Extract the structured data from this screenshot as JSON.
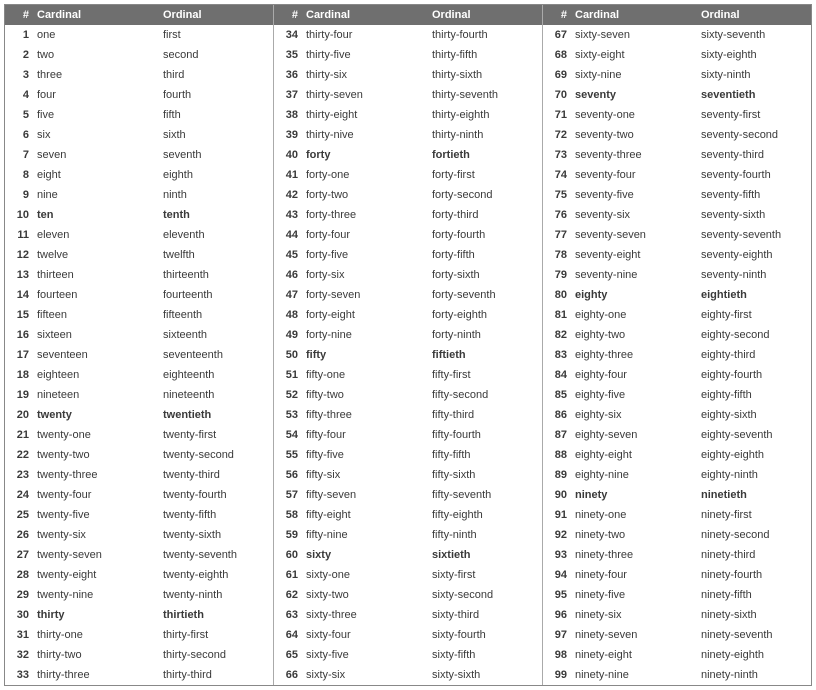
{
  "headers": {
    "num": "#",
    "cardinal": "Cardinal",
    "ordinal": "Ordinal"
  },
  "columns": [
    {
      "rows": [
        {
          "n": "1",
          "cardinal": "one",
          "ordinal": "first",
          "bold": false
        },
        {
          "n": "2",
          "cardinal": "two",
          "ordinal": "second",
          "bold": false
        },
        {
          "n": "3",
          "cardinal": "three",
          "ordinal": "third",
          "bold": false
        },
        {
          "n": "4",
          "cardinal": "four",
          "ordinal": "fourth",
          "bold": false
        },
        {
          "n": "5",
          "cardinal": "five",
          "ordinal": "fifth",
          "bold": false
        },
        {
          "n": "6",
          "cardinal": "six",
          "ordinal": "sixth",
          "bold": false
        },
        {
          "n": "7",
          "cardinal": "seven",
          "ordinal": "seventh",
          "bold": false
        },
        {
          "n": "8",
          "cardinal": "eight",
          "ordinal": "eighth",
          "bold": false
        },
        {
          "n": "9",
          "cardinal": "nine",
          "ordinal": "ninth",
          "bold": false
        },
        {
          "n": "10",
          "cardinal": "ten",
          "ordinal": "tenth",
          "bold": true
        },
        {
          "n": "11",
          "cardinal": "eleven",
          "ordinal": "eleventh",
          "bold": false
        },
        {
          "n": "12",
          "cardinal": "twelve",
          "ordinal": "twelfth",
          "bold": false
        },
        {
          "n": "13",
          "cardinal": "thirteen",
          "ordinal": "thirteenth",
          "bold": false
        },
        {
          "n": "14",
          "cardinal": "fourteen",
          "ordinal": "fourteenth",
          "bold": false
        },
        {
          "n": "15",
          "cardinal": "fifteen",
          "ordinal": "fifteenth",
          "bold": false
        },
        {
          "n": "16",
          "cardinal": "sixteen",
          "ordinal": "sixteenth",
          "bold": false
        },
        {
          "n": "17",
          "cardinal": "seventeen",
          "ordinal": "seventeenth",
          "bold": false
        },
        {
          "n": "18",
          "cardinal": "eighteen",
          "ordinal": "eighteenth",
          "bold": false
        },
        {
          "n": "19",
          "cardinal": "nineteen",
          "ordinal": "nineteenth",
          "bold": false
        },
        {
          "n": "20",
          "cardinal": "twenty",
          "ordinal": "twentieth",
          "bold": true
        },
        {
          "n": "21",
          "cardinal": "twenty-one",
          "ordinal": "twenty-first",
          "bold": false
        },
        {
          "n": "22",
          "cardinal": "twenty-two",
          "ordinal": "twenty-second",
          "bold": false
        },
        {
          "n": "23",
          "cardinal": "twenty-three",
          "ordinal": "twenty-third",
          "bold": false
        },
        {
          "n": "24",
          "cardinal": "twenty-four",
          "ordinal": "twenty-fourth",
          "bold": false
        },
        {
          "n": "25",
          "cardinal": "twenty-five",
          "ordinal": "twenty-fifth",
          "bold": false
        },
        {
          "n": "26",
          "cardinal": "twenty-six",
          "ordinal": "twenty-sixth",
          "bold": false
        },
        {
          "n": "27",
          "cardinal": "twenty-seven",
          "ordinal": "twenty-seventh",
          "bold": false
        },
        {
          "n": "28",
          "cardinal": "twenty-eight",
          "ordinal": "twenty-eighth",
          "bold": false
        },
        {
          "n": "29",
          "cardinal": "twenty-nine",
          "ordinal": "twenty-ninth",
          "bold": false
        },
        {
          "n": "30",
          "cardinal": "thirty",
          "ordinal": "thirtieth",
          "bold": true
        },
        {
          "n": "31",
          "cardinal": "thirty-one",
          "ordinal": "thirty-first",
          "bold": false
        },
        {
          "n": "32",
          "cardinal": "thirty-two",
          "ordinal": "thirty-second",
          "bold": false
        },
        {
          "n": "33",
          "cardinal": "thirty-three",
          "ordinal": "thirty-third",
          "bold": false
        }
      ]
    },
    {
      "rows": [
        {
          "n": "34",
          "cardinal": "thirty-four",
          "ordinal": "thirty-fourth",
          "bold": false
        },
        {
          "n": "35",
          "cardinal": "thirty-five",
          "ordinal": "thirty-fifth",
          "bold": false
        },
        {
          "n": "36",
          "cardinal": "thirty-six",
          "ordinal": "thirty-sixth",
          "bold": false
        },
        {
          "n": "37",
          "cardinal": "thirty-seven",
          "ordinal": "thirty-seventh",
          "bold": false
        },
        {
          "n": "38",
          "cardinal": "thirty-eight",
          "ordinal": "thirty-eighth",
          "bold": false
        },
        {
          "n": "39",
          "cardinal": "thirty-nive",
          "ordinal": "thirty-ninth",
          "bold": false
        },
        {
          "n": "40",
          "cardinal": "forty",
          "ordinal": "fortieth",
          "bold": true
        },
        {
          "n": "41",
          "cardinal": "forty-one",
          "ordinal": "forty-first",
          "bold": false
        },
        {
          "n": "42",
          "cardinal": "forty-two",
          "ordinal": "forty-second",
          "bold": false
        },
        {
          "n": "43",
          "cardinal": "forty-three",
          "ordinal": "forty-third",
          "bold": false
        },
        {
          "n": "44",
          "cardinal": "forty-four",
          "ordinal": "forty-fourth",
          "bold": false
        },
        {
          "n": "45",
          "cardinal": "forty-five",
          "ordinal": "forty-fifth",
          "bold": false
        },
        {
          "n": "46",
          "cardinal": "forty-six",
          "ordinal": "forty-sixth",
          "bold": false
        },
        {
          "n": "47",
          "cardinal": "forty-seven",
          "ordinal": "forty-seventh",
          "bold": false
        },
        {
          "n": "48",
          "cardinal": "forty-eight",
          "ordinal": "forty-eighth",
          "bold": false
        },
        {
          "n": "49",
          "cardinal": "forty-nine",
          "ordinal": "forty-ninth",
          "bold": false
        },
        {
          "n": "50",
          "cardinal": "fifty",
          "ordinal": "fiftieth",
          "bold": true
        },
        {
          "n": "51",
          "cardinal": "fifty-one",
          "ordinal": "fifty-first",
          "bold": false
        },
        {
          "n": "52",
          "cardinal": "fifty-two",
          "ordinal": "fifty-second",
          "bold": false
        },
        {
          "n": "53",
          "cardinal": "fifty-three",
          "ordinal": "fifty-third",
          "bold": false
        },
        {
          "n": "54",
          "cardinal": "fifty-four",
          "ordinal": "fifty-fourth",
          "bold": false
        },
        {
          "n": "55",
          "cardinal": "fifty-five",
          "ordinal": "fifty-fifth",
          "bold": false
        },
        {
          "n": "56",
          "cardinal": "fifty-six",
          "ordinal": "fifty-sixth",
          "bold": false
        },
        {
          "n": "57",
          "cardinal": "fifty-seven",
          "ordinal": "fifty-seventh",
          "bold": false
        },
        {
          "n": "58",
          "cardinal": "fifty-eight",
          "ordinal": "fifty-eighth",
          "bold": false
        },
        {
          "n": "59",
          "cardinal": "fifty-nine",
          "ordinal": "fifty-ninth",
          "bold": false
        },
        {
          "n": "60",
          "cardinal": "sixty",
          "ordinal": "sixtieth",
          "bold": true
        },
        {
          "n": "61",
          "cardinal": "sixty-one",
          "ordinal": "sixty-first",
          "bold": false
        },
        {
          "n": "62",
          "cardinal": "sixty-two",
          "ordinal": "sixty-second",
          "bold": false
        },
        {
          "n": "63",
          "cardinal": "sixty-three",
          "ordinal": "sixty-third",
          "bold": false
        },
        {
          "n": "64",
          "cardinal": "sixty-four",
          "ordinal": "sixty-fourth",
          "bold": false
        },
        {
          "n": "65",
          "cardinal": "sixty-five",
          "ordinal": "sixty-fifth",
          "bold": false
        },
        {
          "n": "66",
          "cardinal": "sixty-six",
          "ordinal": "sixty-sixth",
          "bold": false
        }
      ]
    },
    {
      "rows": [
        {
          "n": "67",
          "cardinal": "sixty-seven",
          "ordinal": "sixty-seventh",
          "bold": false
        },
        {
          "n": "68",
          "cardinal": "sixty-eight",
          "ordinal": "sixty-eighth",
          "bold": false
        },
        {
          "n": "69",
          "cardinal": "sixty-nine",
          "ordinal": "sixty-ninth",
          "bold": false
        },
        {
          "n": "70",
          "cardinal": "seventy",
          "ordinal": "seventieth",
          "bold": true
        },
        {
          "n": "71",
          "cardinal": "seventy-one",
          "ordinal": "seventy-first",
          "bold": false
        },
        {
          "n": "72",
          "cardinal": "seventy-two",
          "ordinal": "seventy-second",
          "bold": false
        },
        {
          "n": "73",
          "cardinal": "seventy-three",
          "ordinal": "seventy-third",
          "bold": false
        },
        {
          "n": "74",
          "cardinal": "seventy-four",
          "ordinal": "seventy-fourth",
          "bold": false
        },
        {
          "n": "75",
          "cardinal": "seventy-five",
          "ordinal": "seventy-fifth",
          "bold": false
        },
        {
          "n": "76",
          "cardinal": "seventy-six",
          "ordinal": "seventy-sixth",
          "bold": false
        },
        {
          "n": "77",
          "cardinal": "seventy-seven",
          "ordinal": "seventy-seventh",
          "bold": false
        },
        {
          "n": "78",
          "cardinal": "seventy-eight",
          "ordinal": "seventy-eighth",
          "bold": false
        },
        {
          "n": "79",
          "cardinal": "seventy-nine",
          "ordinal": "seventy-ninth",
          "bold": false
        },
        {
          "n": "80",
          "cardinal": "eighty",
          "ordinal": "eightieth",
          "bold": true
        },
        {
          "n": "81",
          "cardinal": "eighty-one",
          "ordinal": "eighty-first",
          "bold": false
        },
        {
          "n": "82",
          "cardinal": "eighty-two",
          "ordinal": "eighty-second",
          "bold": false
        },
        {
          "n": "83",
          "cardinal": "eighty-three",
          "ordinal": "eighty-third",
          "bold": false
        },
        {
          "n": "84",
          "cardinal": "eighty-four",
          "ordinal": "eighty-fourth",
          "bold": false
        },
        {
          "n": "85",
          "cardinal": "eighty-five",
          "ordinal": "eighty-fifth",
          "bold": false
        },
        {
          "n": "86",
          "cardinal": "eighty-six",
          "ordinal": "eighty-sixth",
          "bold": false
        },
        {
          "n": "87",
          "cardinal": "eighty-seven",
          "ordinal": "eighty-seventh",
          "bold": false
        },
        {
          "n": "88",
          "cardinal": "eighty-eight",
          "ordinal": "eighty-eighth",
          "bold": false
        },
        {
          "n": "89",
          "cardinal": "eighty-nine",
          "ordinal": "eighty-ninth",
          "bold": false
        },
        {
          "n": "90",
          "cardinal": "ninety",
          "ordinal": "ninetieth",
          "bold": true
        },
        {
          "n": "91",
          "cardinal": "ninety-one",
          "ordinal": "ninety-first",
          "bold": false
        },
        {
          "n": "92",
          "cardinal": "ninety-two",
          "ordinal": "ninety-second",
          "bold": false
        },
        {
          "n": "93",
          "cardinal": "ninety-three",
          "ordinal": "ninety-third",
          "bold": false
        },
        {
          "n": "94",
          "cardinal": "ninety-four",
          "ordinal": "ninety-fourth",
          "bold": false
        },
        {
          "n": "95",
          "cardinal": "ninety-five",
          "ordinal": "ninety-fifth",
          "bold": false
        },
        {
          "n": "96",
          "cardinal": "ninety-six",
          "ordinal": "ninety-sixth",
          "bold": false
        },
        {
          "n": "97",
          "cardinal": "ninety-seven",
          "ordinal": "ninety-seventh",
          "bold": false
        },
        {
          "n": "98",
          "cardinal": "ninety-eight",
          "ordinal": "ninety-eighth",
          "bold": false
        },
        {
          "n": "99",
          "cardinal": "ninety-nine",
          "ordinal": "ninety-ninth",
          "bold": false
        }
      ]
    }
  ]
}
